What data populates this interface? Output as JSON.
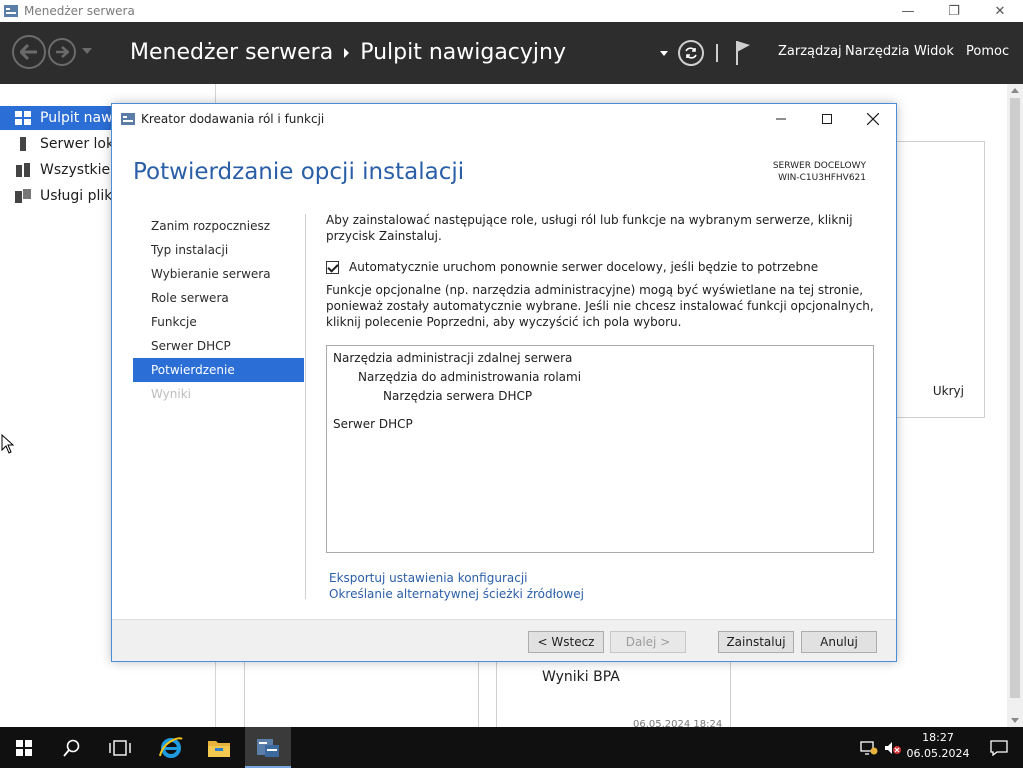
{
  "window": {
    "title": "Menedżer serwera",
    "controls": {
      "minimize": "—",
      "restore": "❐",
      "close": "✕"
    }
  },
  "header": {
    "breadcrumb_app": "Menedżer serwera",
    "breadcrumb_page": "Pulpit nawigacyjny",
    "menu": [
      "Zarządzaj",
      "Narzędzia",
      "Widok",
      "Pomoc"
    ]
  },
  "sidebar": {
    "items": [
      {
        "label": "Pulpit nawig",
        "icon": "dashboard-icon",
        "active": true
      },
      {
        "label": "Serwer loka",
        "icon": "local-server-icon",
        "active": false
      },
      {
        "label": "Wszystkie s",
        "icon": "all-servers-icon",
        "active": false
      },
      {
        "label": "Usługi plikó",
        "icon": "file-services-icon",
        "active": false
      }
    ]
  },
  "background": {
    "hide_label": "Ukryj",
    "tile_label": "Wyniki BPA",
    "tile_timestamp": "06.05.2024 18:24"
  },
  "wizard": {
    "title": "Kreator dodawania ról i funkcji",
    "heading": "Potwierdzanie opcji instalacji",
    "destination_label": "SERWER DOCELOWY",
    "destination_server": "WIN-C1U3HFHV621",
    "steps": [
      {
        "label": "Zanim rozpoczniesz",
        "state": "normal"
      },
      {
        "label": "Typ instalacji",
        "state": "normal"
      },
      {
        "label": "Wybieranie serwera",
        "state": "normal"
      },
      {
        "label": "Role serwera",
        "state": "normal"
      },
      {
        "label": "Funkcje",
        "state": "normal"
      },
      {
        "label": "Serwer DHCP",
        "state": "normal"
      },
      {
        "label": "Potwierdzenie",
        "state": "active"
      },
      {
        "label": "Wyniki",
        "state": "disabled"
      }
    ],
    "intro": "Aby zainstalować następujące role, usługi ról lub funkcje na wybranym serwerze, kliknij przycisk Zainstaluj.",
    "restart_checkbox": {
      "label": "Automatycznie uruchom ponownie serwer docelowy, jeśli będzie to potrzebne",
      "checked": true
    },
    "note": "Funkcje opcjonalne (np. narzędzia administracyjne) mogą być wyświetlane na tej stronie, ponieważ zostały automatycznie wybrane. Jeśli nie chcesz instalować funkcji opcjonalnych, kliknij polecenie Poprzedni, aby wyczyścić ich pola wyboru.",
    "install_items": [
      {
        "text": "Narzędzia administracji zdalnej serwera",
        "level": 0
      },
      {
        "text": "Narzędzia do administrowania rolami",
        "level": 1
      },
      {
        "text": "Narzędzia serwera DHCP",
        "level": 2
      },
      {
        "text": "Serwer DHCP",
        "level": 0
      }
    ],
    "links": {
      "export": "Eksportuj ustawienia konfiguracji",
      "alt_source": "Określanie alternatywnej ścieżki źródłowej"
    },
    "buttons": {
      "previous": "< Wstecz",
      "next": "Dalej >",
      "install": "Zainstaluj",
      "cancel": "Anuluj"
    }
  },
  "taskbar": {
    "time": "18:27",
    "date": "06.05.2024"
  },
  "colors": {
    "header_bg": "#2d2d2d",
    "accent": "#2b6ed6",
    "heading": "#2a5fa8",
    "taskbar_bg": "#101010"
  }
}
